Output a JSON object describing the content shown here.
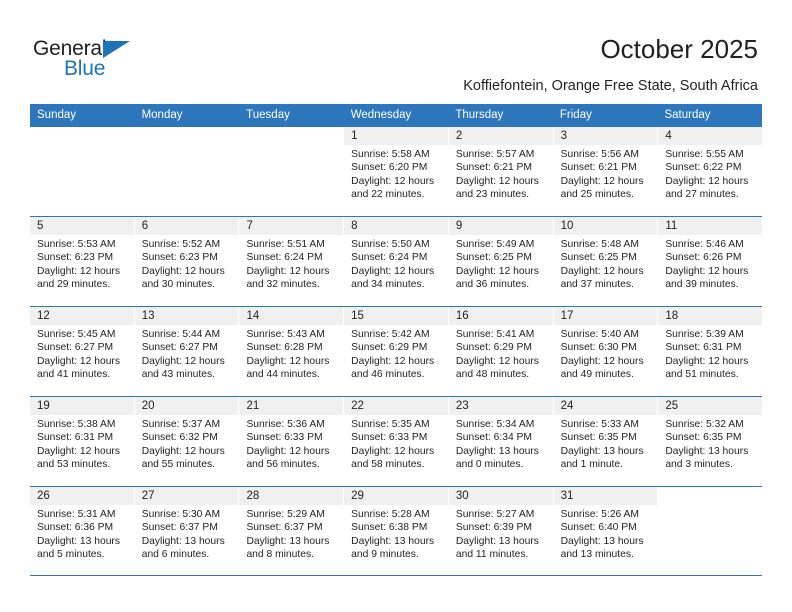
{
  "brand": {
    "name_part1": "General",
    "name_part2": "Blue",
    "accent_color": "#1f73b8"
  },
  "header": {
    "title": "October 2025",
    "subtitle": "Koffiefontein, Orange Free State, South Africa"
  },
  "theme": {
    "header_blue": "#2e76bc",
    "daynum_band": "#f0f0f0",
    "text": "#231f20"
  },
  "weekdays": [
    "Sunday",
    "Monday",
    "Tuesday",
    "Wednesday",
    "Thursday",
    "Friday",
    "Saturday"
  ],
  "labels": {
    "sunrise_prefix": "Sunrise:",
    "sunset_prefix": "Sunset:",
    "daylight_prefix": "Daylight:"
  },
  "weeks": [
    [
      {
        "empty": true
      },
      {
        "empty": true
      },
      {
        "empty": true
      },
      {
        "day": "1",
        "sunrise": "Sunrise: 5:58 AM",
        "sunset": "Sunset: 6:20 PM",
        "daylight_line1": "Daylight: 12 hours",
        "daylight_line2": "and 22 minutes."
      },
      {
        "day": "2",
        "sunrise": "Sunrise: 5:57 AM",
        "sunset": "Sunset: 6:21 PM",
        "daylight_line1": "Daylight: 12 hours",
        "daylight_line2": "and 23 minutes."
      },
      {
        "day": "3",
        "sunrise": "Sunrise: 5:56 AM",
        "sunset": "Sunset: 6:21 PM",
        "daylight_line1": "Daylight: 12 hours",
        "daylight_line2": "and 25 minutes."
      },
      {
        "day": "4",
        "sunrise": "Sunrise: 5:55 AM",
        "sunset": "Sunset: 6:22 PM",
        "daylight_line1": "Daylight: 12 hours",
        "daylight_line2": "and 27 minutes."
      }
    ],
    [
      {
        "day": "5",
        "sunrise": "Sunrise: 5:53 AM",
        "sunset": "Sunset: 6:23 PM",
        "daylight_line1": "Daylight: 12 hours",
        "daylight_line2": "and 29 minutes."
      },
      {
        "day": "6",
        "sunrise": "Sunrise: 5:52 AM",
        "sunset": "Sunset: 6:23 PM",
        "daylight_line1": "Daylight: 12 hours",
        "daylight_line2": "and 30 minutes."
      },
      {
        "day": "7",
        "sunrise": "Sunrise: 5:51 AM",
        "sunset": "Sunset: 6:24 PM",
        "daylight_line1": "Daylight: 12 hours",
        "daylight_line2": "and 32 minutes."
      },
      {
        "day": "8",
        "sunrise": "Sunrise: 5:50 AM",
        "sunset": "Sunset: 6:24 PM",
        "daylight_line1": "Daylight: 12 hours",
        "daylight_line2": "and 34 minutes."
      },
      {
        "day": "9",
        "sunrise": "Sunrise: 5:49 AM",
        "sunset": "Sunset: 6:25 PM",
        "daylight_line1": "Daylight: 12 hours",
        "daylight_line2": "and 36 minutes."
      },
      {
        "day": "10",
        "sunrise": "Sunrise: 5:48 AM",
        "sunset": "Sunset: 6:25 PM",
        "daylight_line1": "Daylight: 12 hours",
        "daylight_line2": "and 37 minutes."
      },
      {
        "day": "11",
        "sunrise": "Sunrise: 5:46 AM",
        "sunset": "Sunset: 6:26 PM",
        "daylight_line1": "Daylight: 12 hours",
        "daylight_line2": "and 39 minutes."
      }
    ],
    [
      {
        "day": "12",
        "sunrise": "Sunrise: 5:45 AM",
        "sunset": "Sunset: 6:27 PM",
        "daylight_line1": "Daylight: 12 hours",
        "daylight_line2": "and 41 minutes."
      },
      {
        "day": "13",
        "sunrise": "Sunrise: 5:44 AM",
        "sunset": "Sunset: 6:27 PM",
        "daylight_line1": "Daylight: 12 hours",
        "daylight_line2": "and 43 minutes."
      },
      {
        "day": "14",
        "sunrise": "Sunrise: 5:43 AM",
        "sunset": "Sunset: 6:28 PM",
        "daylight_line1": "Daylight: 12 hours",
        "daylight_line2": "and 44 minutes."
      },
      {
        "day": "15",
        "sunrise": "Sunrise: 5:42 AM",
        "sunset": "Sunset: 6:29 PM",
        "daylight_line1": "Daylight: 12 hours",
        "daylight_line2": "and 46 minutes."
      },
      {
        "day": "16",
        "sunrise": "Sunrise: 5:41 AM",
        "sunset": "Sunset: 6:29 PM",
        "daylight_line1": "Daylight: 12 hours",
        "daylight_line2": "and 48 minutes."
      },
      {
        "day": "17",
        "sunrise": "Sunrise: 5:40 AM",
        "sunset": "Sunset: 6:30 PM",
        "daylight_line1": "Daylight: 12 hours",
        "daylight_line2": "and 49 minutes."
      },
      {
        "day": "18",
        "sunrise": "Sunrise: 5:39 AM",
        "sunset": "Sunset: 6:31 PM",
        "daylight_line1": "Daylight: 12 hours",
        "daylight_line2": "and 51 minutes."
      }
    ],
    [
      {
        "day": "19",
        "sunrise": "Sunrise: 5:38 AM",
        "sunset": "Sunset: 6:31 PM",
        "daylight_line1": "Daylight: 12 hours",
        "daylight_line2": "and 53 minutes."
      },
      {
        "day": "20",
        "sunrise": "Sunrise: 5:37 AM",
        "sunset": "Sunset: 6:32 PM",
        "daylight_line1": "Daylight: 12 hours",
        "daylight_line2": "and 55 minutes."
      },
      {
        "day": "21",
        "sunrise": "Sunrise: 5:36 AM",
        "sunset": "Sunset: 6:33 PM",
        "daylight_line1": "Daylight: 12 hours",
        "daylight_line2": "and 56 minutes."
      },
      {
        "day": "22",
        "sunrise": "Sunrise: 5:35 AM",
        "sunset": "Sunset: 6:33 PM",
        "daylight_line1": "Daylight: 12 hours",
        "daylight_line2": "and 58 minutes."
      },
      {
        "day": "23",
        "sunrise": "Sunrise: 5:34 AM",
        "sunset": "Sunset: 6:34 PM",
        "daylight_line1": "Daylight: 13 hours",
        "daylight_line2": "and 0 minutes."
      },
      {
        "day": "24",
        "sunrise": "Sunrise: 5:33 AM",
        "sunset": "Sunset: 6:35 PM",
        "daylight_line1": "Daylight: 13 hours",
        "daylight_line2": "and 1 minute."
      },
      {
        "day": "25",
        "sunrise": "Sunrise: 5:32 AM",
        "sunset": "Sunset: 6:35 PM",
        "daylight_line1": "Daylight: 13 hours",
        "daylight_line2": "and 3 minutes."
      }
    ],
    [
      {
        "day": "26",
        "sunrise": "Sunrise: 5:31 AM",
        "sunset": "Sunset: 6:36 PM",
        "daylight_line1": "Daylight: 13 hours",
        "daylight_line2": "and 5 minutes."
      },
      {
        "day": "27",
        "sunrise": "Sunrise: 5:30 AM",
        "sunset": "Sunset: 6:37 PM",
        "daylight_line1": "Daylight: 13 hours",
        "daylight_line2": "and 6 minutes."
      },
      {
        "day": "28",
        "sunrise": "Sunrise: 5:29 AM",
        "sunset": "Sunset: 6:37 PM",
        "daylight_line1": "Daylight: 13 hours",
        "daylight_line2": "and 8 minutes."
      },
      {
        "day": "29",
        "sunrise": "Sunrise: 5:28 AM",
        "sunset": "Sunset: 6:38 PM",
        "daylight_line1": "Daylight: 13 hours",
        "daylight_line2": "and 9 minutes."
      },
      {
        "day": "30",
        "sunrise": "Sunrise: 5:27 AM",
        "sunset": "Sunset: 6:39 PM",
        "daylight_line1": "Daylight: 13 hours",
        "daylight_line2": "and 11 minutes."
      },
      {
        "day": "31",
        "sunrise": "Sunrise: 5:26 AM",
        "sunset": "Sunset: 6:40 PM",
        "daylight_line1": "Daylight: 13 hours",
        "daylight_line2": "and 13 minutes."
      },
      {
        "empty": true
      }
    ]
  ]
}
